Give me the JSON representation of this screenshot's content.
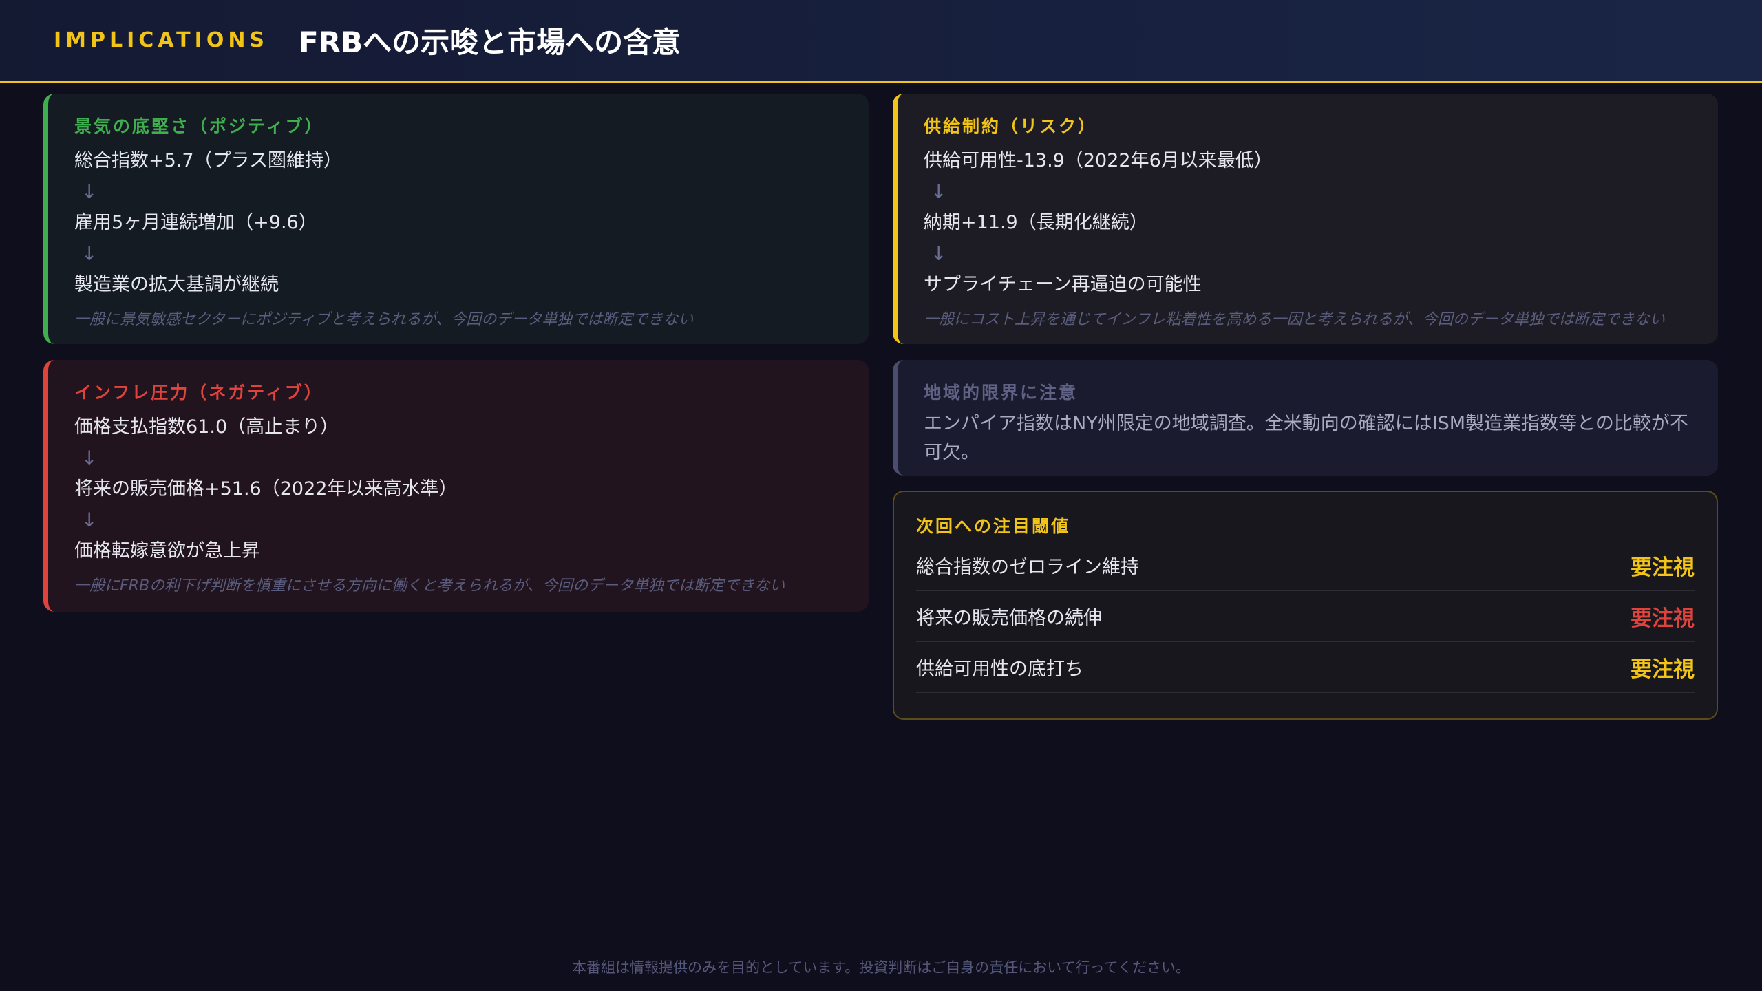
{
  "header": {
    "kicker": "IMPLICATIONS",
    "title": "FRBへの示唆と市場への含意"
  },
  "cards": {
    "positive": {
      "title": "景気の底堅さ（ポジティブ）",
      "items": [
        "総合指数+5.7（プラス圏維持）",
        "雇用5ヶ月連続増加（+9.6）",
        "製造業の拡大基調が継続"
      ],
      "arrow": "↓",
      "note": "一般に景気敏感セクターにポジティブと考えられるが、今回のデータ単独では断定できない"
    },
    "supply": {
      "title": "供給制約（リスク）",
      "items": [
        "供給可用性-13.9（2022年6月以来最低）",
        "納期+11.9（長期化継続）",
        "サプライチェーン再逼迫の可能性"
      ],
      "arrow": "↓",
      "note": "一般にコスト上昇を通じてインフレ粘着性を高める一因と考えられるが、今回のデータ単独では断定できない"
    },
    "inflation": {
      "title": "インフレ圧力（ネガティブ）",
      "items": [
        "価格支払指数61.0（高止まり）",
        "将来の販売価格+51.6（2022年以来高水準）",
        "価格転嫁意欲が急上昇"
      ],
      "arrow": "↓",
      "note": "一般にFRBの利下げ判断を慎重にさせる方向に働くと考えられるが、今回のデータ単独では断定できない"
    },
    "regional": {
      "title": "地域的限界に注意",
      "body": "エンパイア指数はNY州限定の地域調査。全米動向の確認にはISM製造業指数等との比較が不可欠。"
    },
    "watch": {
      "title": "次回への注目閾値",
      "rows": [
        {
          "label": "総合指数のゼロライン維持",
          "status": "要注視",
          "color": "#f2c418"
        },
        {
          "label": "将来の販売価格の続伸",
          "status": "要注視",
          "color": "#e0433b"
        },
        {
          "label": "供給可用性の底打ち",
          "status": "要注視",
          "color": "#f2c418"
        }
      ]
    }
  },
  "footer": {
    "disclaimer": "本番組は情報提供のみを目的としています。投資判断はご自身の責任において行ってください。"
  },
  "colors": {
    "accent": "#f2c418",
    "positive": "#3fae4e",
    "negative": "#e0433b",
    "neutral": "#4a4d6e"
  }
}
